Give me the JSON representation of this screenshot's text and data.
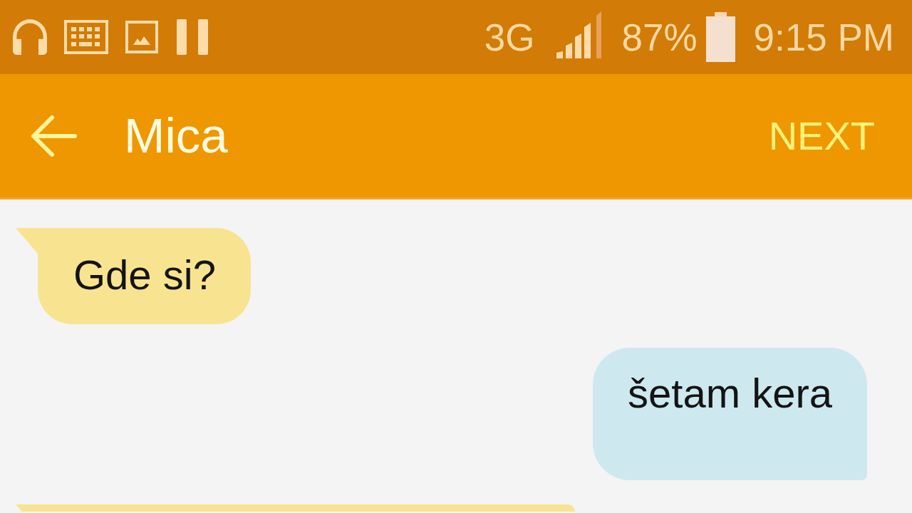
{
  "status_bar": {
    "network": "3G",
    "battery": "87%",
    "time": "9:15 PM"
  },
  "app_bar": {
    "title": "Mica",
    "action": "NEXT"
  },
  "messages": [
    {
      "kind": "incoming",
      "text": "Gde si?"
    },
    {
      "kind": "outgoing",
      "text": "šetam kera"
    },
    {
      "kind": "incoming"
    }
  ]
}
